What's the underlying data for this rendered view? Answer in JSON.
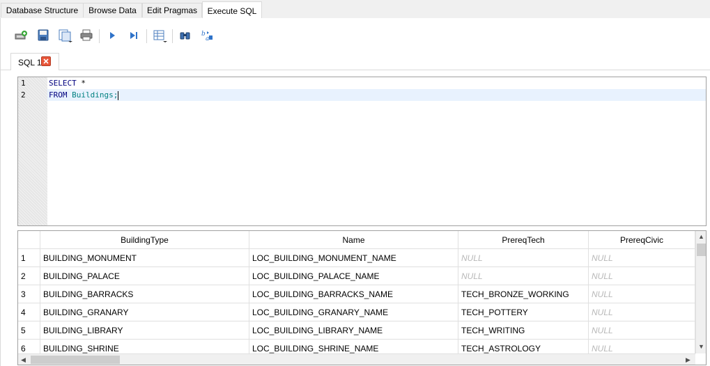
{
  "main_tabs": [
    "Database Structure",
    "Browse Data",
    "Edit Pragmas",
    "Execute SQL"
  ],
  "sql_tab": {
    "label": "SQL 1"
  },
  "editor": {
    "line_numbers": [
      "1",
      "2"
    ],
    "line1": {
      "keyword": "SELECT",
      "rest": " *"
    },
    "line2": {
      "keyword": "FROM",
      "table": "Buildings",
      "end": ";"
    }
  },
  "results": {
    "headers": [
      "BuildingType",
      "Name",
      "PrereqTech",
      "PrereqCivic"
    ],
    "rows": [
      {
        "num": "1",
        "building_type": "BUILDING_MONUMENT",
        "name": "LOC_BUILDING_MONUMENT_NAME",
        "prereq_tech": "NULL",
        "prereq_civic": "NULL"
      },
      {
        "num": "2",
        "building_type": "BUILDING_PALACE",
        "name": "LOC_BUILDING_PALACE_NAME",
        "prereq_tech": "NULL",
        "prereq_civic": "NULL"
      },
      {
        "num": "3",
        "building_type": "BUILDING_BARRACKS",
        "name": "LOC_BUILDING_BARRACKS_NAME",
        "prereq_tech": "TECH_BRONZE_WORKING",
        "prereq_civic": "NULL"
      },
      {
        "num": "4",
        "building_type": "BUILDING_GRANARY",
        "name": "LOC_BUILDING_GRANARY_NAME",
        "prereq_tech": "TECH_POTTERY",
        "prereq_civic": "NULL"
      },
      {
        "num": "5",
        "building_type": "BUILDING_LIBRARY",
        "name": "LOC_BUILDING_LIBRARY_NAME",
        "prereq_tech": "TECH_WRITING",
        "prereq_civic": "NULL"
      },
      {
        "num": "6",
        "building_type": "BUILDING_SHRINE",
        "name": "LOC_BUILDING_SHRINE_NAME",
        "prereq_tech": "TECH_ASTROLOGY",
        "prereq_civic": "NULL"
      }
    ]
  },
  "toolbar": {
    "icons": [
      "open-tab-icon",
      "save-icon",
      "save-as-icon",
      "print-icon",
      "execute-all-icon",
      "execute-current-line-icon",
      "save-results-icon",
      "find-icon",
      "find-replace-icon"
    ]
  },
  "colors": {
    "keyword": "#00007f",
    "identifier": "#008080",
    "null_text": "#b8b8b8",
    "close_button": "#e8563a"
  }
}
